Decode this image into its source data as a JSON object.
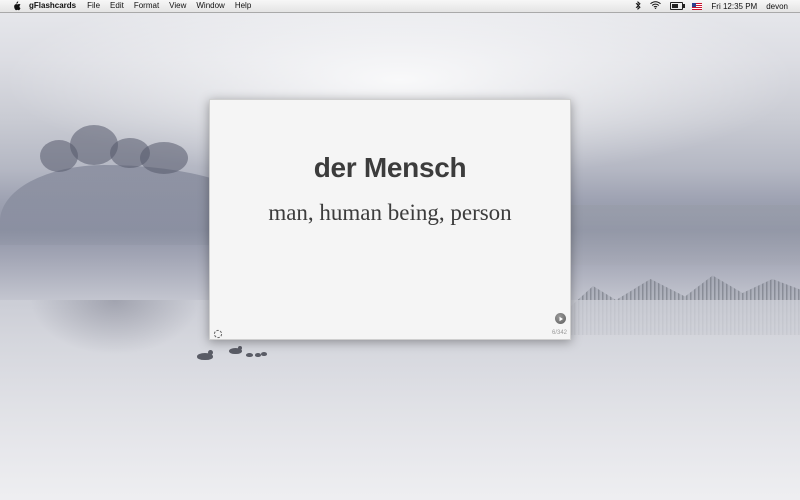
{
  "menubar": {
    "app_name": "gFlashcards",
    "menus": [
      "File",
      "Edit",
      "Format",
      "View",
      "Window",
      "Help"
    ],
    "clock": "Fri 12:35 PM",
    "user": "devon",
    "battery_level": 0.6,
    "icons": [
      "apple-icon",
      "bluetooth-icon",
      "wifi-icon",
      "battery-icon",
      "us-flag-icon"
    ]
  },
  "card": {
    "term": "der Mensch",
    "definition": "man, human being, person",
    "counter": "6/342",
    "icons": [
      "shuffle-icon",
      "play-icon"
    ]
  }
}
